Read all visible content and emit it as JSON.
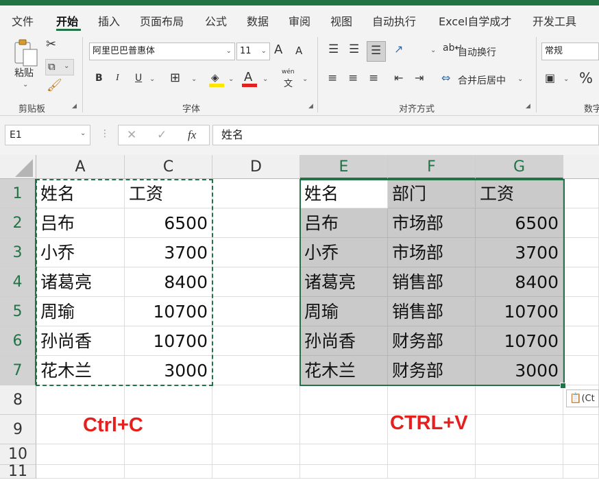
{
  "ribbon_tabs": [
    "文件",
    "开始",
    "插入",
    "页面布局",
    "公式",
    "数据",
    "审阅",
    "视图",
    "自动执行",
    "Excel自学成才",
    "开发工具"
  ],
  "ribbon": {
    "clipboard": {
      "paste_label": "粘贴",
      "group_label": "剪贴板"
    },
    "font": {
      "font_name": "阿里巴巴普惠体",
      "font_size": "11",
      "bold": "B",
      "italic": "I",
      "underline": "U",
      "grow": "A",
      "shrink": "A",
      "font_color_letter": "A",
      "phonetic": "wén",
      "group_label": "字体"
    },
    "alignment": {
      "wrap_text": "自动换行",
      "merge_center": "合并后居中",
      "group_label": "对齐方式"
    },
    "number": {
      "format": "常规",
      "percent": "%",
      "group_label": "数字"
    },
    "colors": {
      "accent": "#217346",
      "highlight": "#ffe600",
      "font_color": "#e51e1e"
    }
  },
  "formula_bar": {
    "name_box": "E1",
    "fx": "fx",
    "content": "姓名",
    "cancel": "✕",
    "enter": "✓"
  },
  "grid": {
    "col_headers": [
      "A",
      "C",
      "D",
      "E",
      "F",
      "G"
    ],
    "row_headers": [
      "1",
      "2",
      "3",
      "4",
      "5",
      "6",
      "7",
      "8",
      "9",
      "10",
      "11"
    ],
    "left_table": [
      [
        "姓名",
        "工资"
      ],
      [
        "吕布",
        "6500"
      ],
      [
        "小乔",
        "3700"
      ],
      [
        "诸葛亮",
        "8400"
      ],
      [
        "周瑜",
        "10700"
      ],
      [
        "孙尚香",
        "10700"
      ],
      [
        "花木兰",
        "3000"
      ]
    ],
    "right_table": [
      [
        "姓名",
        "部门",
        "工资"
      ],
      [
        "吕布",
        "市场部",
        "6500"
      ],
      [
        "小乔",
        "市场部",
        "3700"
      ],
      [
        "诸葛亮",
        "销售部",
        "8400"
      ],
      [
        "周瑜",
        "销售部",
        "10700"
      ],
      [
        "孙尚香",
        "财务部",
        "10700"
      ],
      [
        "花木兰",
        "财务部",
        "3000"
      ]
    ],
    "paste_options": "(Ct"
  },
  "annotations": {
    "copy": "Ctrl+C",
    "paste": "CTRL+V"
  }
}
